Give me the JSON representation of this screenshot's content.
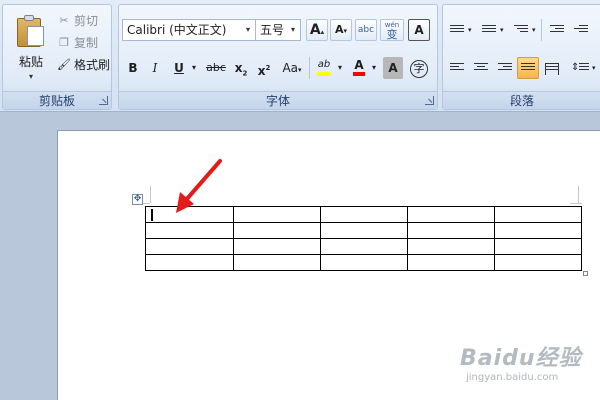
{
  "clipboard": {
    "group_label": "剪贴板",
    "paste_label": "粘贴",
    "cut_label": "剪切",
    "copy_label": "复制",
    "format_painter_label": "格式刷"
  },
  "font": {
    "group_label": "字体",
    "font_name": "Calibri (中文正文)",
    "font_size": "五号",
    "grow_font": "A",
    "shrink_font": "A",
    "pinyin": "abc",
    "change_case_wen": "wén",
    "change_case_char": "变",
    "char_border": "A",
    "bold": "B",
    "italic": "I",
    "underline": "U",
    "strikethrough": "abc",
    "subscript": "x",
    "subscript_mark": "2",
    "superscript": "x",
    "superscript_mark": "2",
    "change_case": "Aa",
    "highlight_label": "ab",
    "font_color_label": "A",
    "char_shading": "A",
    "enclose_char": "字",
    "highlight_color": "#ffff00",
    "font_color": "#ff0000"
  },
  "paragraph": {
    "group_label": "段落"
  },
  "watermark": {
    "main": "Baidu经验",
    "sub": "jingyan.baidu.com"
  },
  "colors": {
    "annotation_arrow": "#e31b1b",
    "active_button": "#f7b54a"
  }
}
